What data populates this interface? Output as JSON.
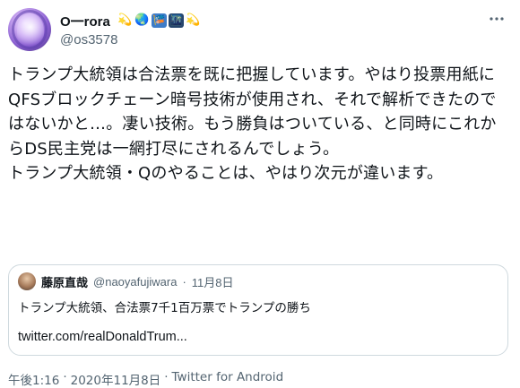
{
  "author": {
    "display_name": "O一rora",
    "handle": "@os3578",
    "emojis": [
      "💫",
      "🌏",
      "🎏",
      "🌃",
      "💫"
    ]
  },
  "more_icon": "more-options-icon",
  "tweet": {
    "text": "トランプ大統領は合法票を既に把握しています。やはり投票用紙にQFSブロックチェーン暗号技術が使用され、それで解析できたのではないかと…。凄い技術。もう勝負はついている、と同時にこれからDS民主党は一網打尽にされるんでしょう。\nトランプ大統領・Qのやることは、やはり次元が違います。"
  },
  "quote": {
    "name": "藤原直哉",
    "handle": "@naoyafujiwara",
    "dot": "·",
    "date": "11月8日",
    "text": "トランプ大統領、合法票7千1百万票でトランプの勝ち",
    "link": "twitter.com/realDonaldTrum..."
  },
  "meta": {
    "time": "午後1:16",
    "sep1": "·",
    "date": "2020年11月8日",
    "sep2": "·",
    "source": "Twitter for Android"
  }
}
